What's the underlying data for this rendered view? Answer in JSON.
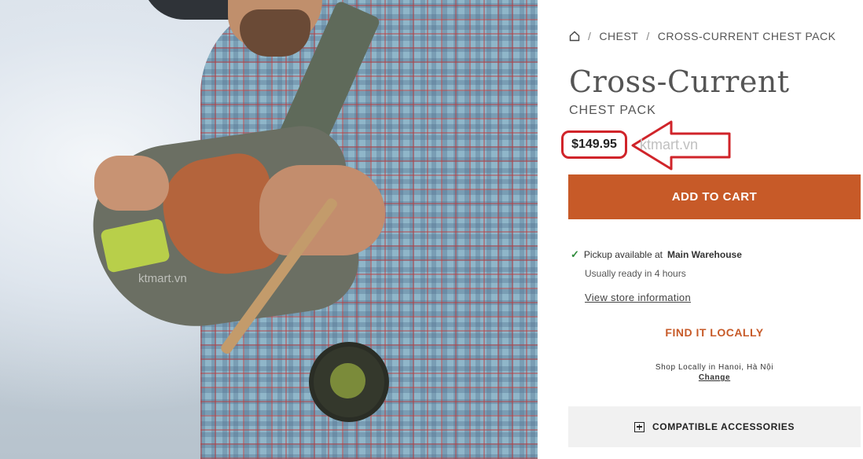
{
  "breadcrumb": {
    "home_icon": "home-icon",
    "separator": "/",
    "items": [
      "CHEST",
      "CROSS-CURRENT CHEST PACK"
    ]
  },
  "product": {
    "name": "Cross-Current",
    "subtitle": "CHEST PACK",
    "price": "$149.95"
  },
  "watermark": "ktmart.vn",
  "cart": {
    "label": "ADD TO CART"
  },
  "pickup": {
    "prefix": "Pickup available at",
    "store": "Main Warehouse",
    "ready": "Usually ready in 4 hours",
    "store_link": "View store information"
  },
  "find_locally": {
    "label": "FIND IT LOCALLY",
    "shop_text": "Shop Locally in Hanoi, Hà Nội",
    "change_label": "Change"
  },
  "accessories": {
    "label": "COMPATIBLE ACCESSORIES"
  },
  "colors": {
    "accent": "#c75a28",
    "highlight": "#d0242a",
    "check": "#2e8b3a"
  }
}
